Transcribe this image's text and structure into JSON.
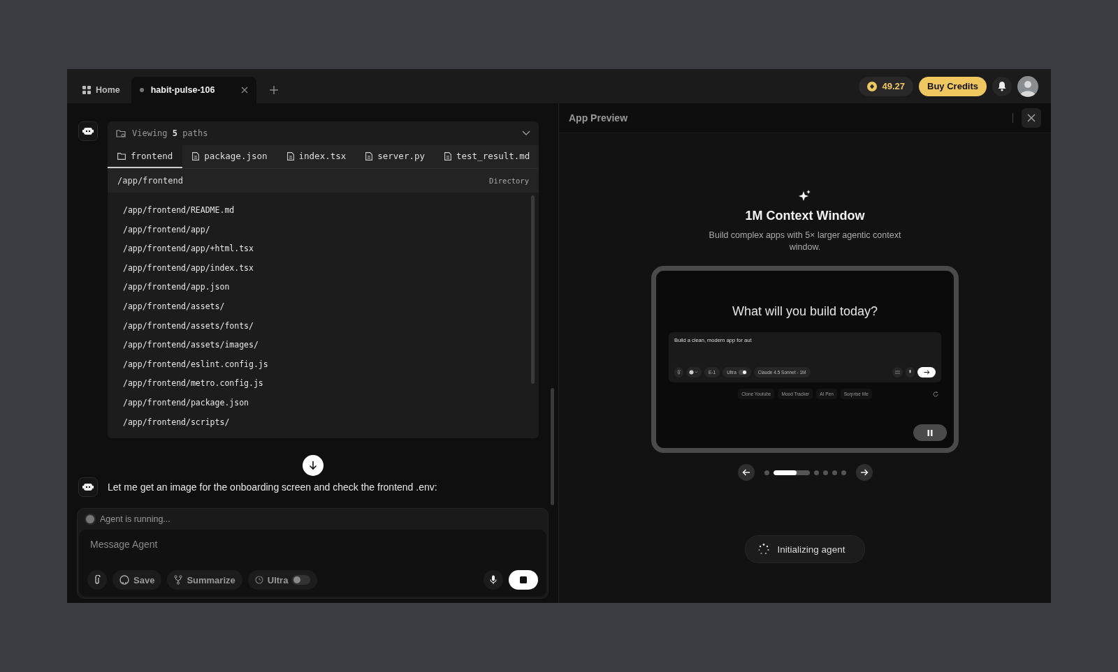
{
  "top_tabs": [
    {
      "kind": "home",
      "label": "Home",
      "selected": false
    },
    {
      "kind": "project",
      "label": "habit-pulse-106",
      "selected": true
    }
  ],
  "credits": "49.27",
  "buy_button": "Buy Credits",
  "viewer": {
    "title_prefix": "Viewing",
    "count": "5",
    "title_suffix": "paths",
    "tabs": [
      {
        "kind": "folder",
        "label": "frontend",
        "selected": true
      },
      {
        "kind": "file",
        "label": "package.json",
        "selected": false
      },
      {
        "kind": "file",
        "label": "index.tsx",
        "selected": false
      },
      {
        "kind": "file",
        "label": "server.py",
        "selected": false
      },
      {
        "kind": "file",
        "label": "test_result.md",
        "selected": false
      }
    ],
    "path": "/app/frontend",
    "path_type": "Directory",
    "entries": [
      "/app/frontend/README.md",
      "/app/frontend/app/",
      "/app/frontend/app/+html.tsx",
      "/app/frontend/app/index.tsx",
      "/app/frontend/app.json",
      "/app/frontend/assets/",
      "/app/frontend/assets/fonts/",
      "/app/frontend/assets/images/",
      "/app/frontend/eslint.config.js",
      "/app/frontend/metro.config.js",
      "/app/frontend/package.json",
      "/app/frontend/scripts/"
    ]
  },
  "message": "Let me get an image for the onboarding screen and check the frontend .env:",
  "status": "Agent is running...",
  "composer": {
    "placeholder": "Message Agent",
    "save": "Save",
    "summarize": "Summarize",
    "ultra": "Ultra",
    "ultra_on": false
  },
  "preview": {
    "title": "App Preview",
    "headline": "1M Context Window",
    "description": "Build complex apps with 5× larger agentic context window.",
    "mock": {
      "title": "What will you build today?",
      "prompt": "Build a clean, modern app for aut",
      "agent": "E-1",
      "ultra": "Ultra",
      "ultra_on": true,
      "model": "Claude 4.5 Sonnet - 1M",
      "suggestions": [
        "Clone Youtube",
        "Mood Tracker",
        "AI Pen",
        "Surprise Me"
      ]
    },
    "slides": [
      {
        "selected": false
      },
      {
        "selected": true,
        "level": 0.65
      },
      {
        "selected": false
      },
      {
        "selected": false
      },
      {
        "selected": false
      },
      {
        "selected": false
      }
    ],
    "loading": "Initializing agent"
  }
}
